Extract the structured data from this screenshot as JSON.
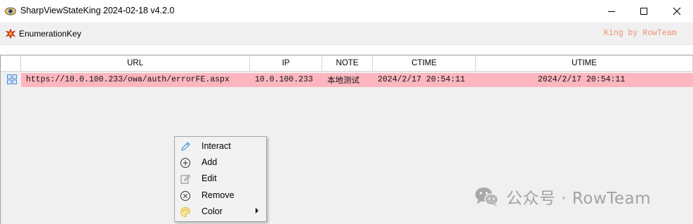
{
  "window": {
    "title": "SharpViewStateKing 2024-02-18 v4.2.0",
    "icon": "eye-icon"
  },
  "toolbar": {
    "enumeration_key_label": "EnumerationKey",
    "enumeration_key_icon": "star-burst-icon",
    "brand": "King by RowTeam"
  },
  "grid": {
    "columns": [
      "URL",
      "IP",
      "NOTE",
      "CTIME",
      "UTIME"
    ],
    "rows": [
      {
        "url": "https://10.0.100.233/owa/auth/errorFE.aspx",
        "ip": "10.0.100.233",
        "note": "本地测试",
        "ctime": "2024/2/17 20:54:11",
        "utime": "2024/2/17 20:54:11",
        "highlight_color": "#ffb6bf"
      }
    ]
  },
  "context_menu": {
    "items": [
      {
        "label": "Interact",
        "icon": "pencil-icon"
      },
      {
        "label": "Add",
        "icon": "plus-circle-icon"
      },
      {
        "label": "Edit",
        "icon": "edit-icon"
      },
      {
        "label": "Remove",
        "icon": "x-circle-icon"
      },
      {
        "label": "Color",
        "icon": "palette-icon",
        "submenu": true
      }
    ]
  },
  "watermark": {
    "text": "公众号 · RowTeam",
    "icon": "wechat-icon"
  },
  "colors": {
    "row_highlight": "#ffb6bf",
    "brand_text": "#e9927a",
    "watermark": "#a3a3a3"
  }
}
